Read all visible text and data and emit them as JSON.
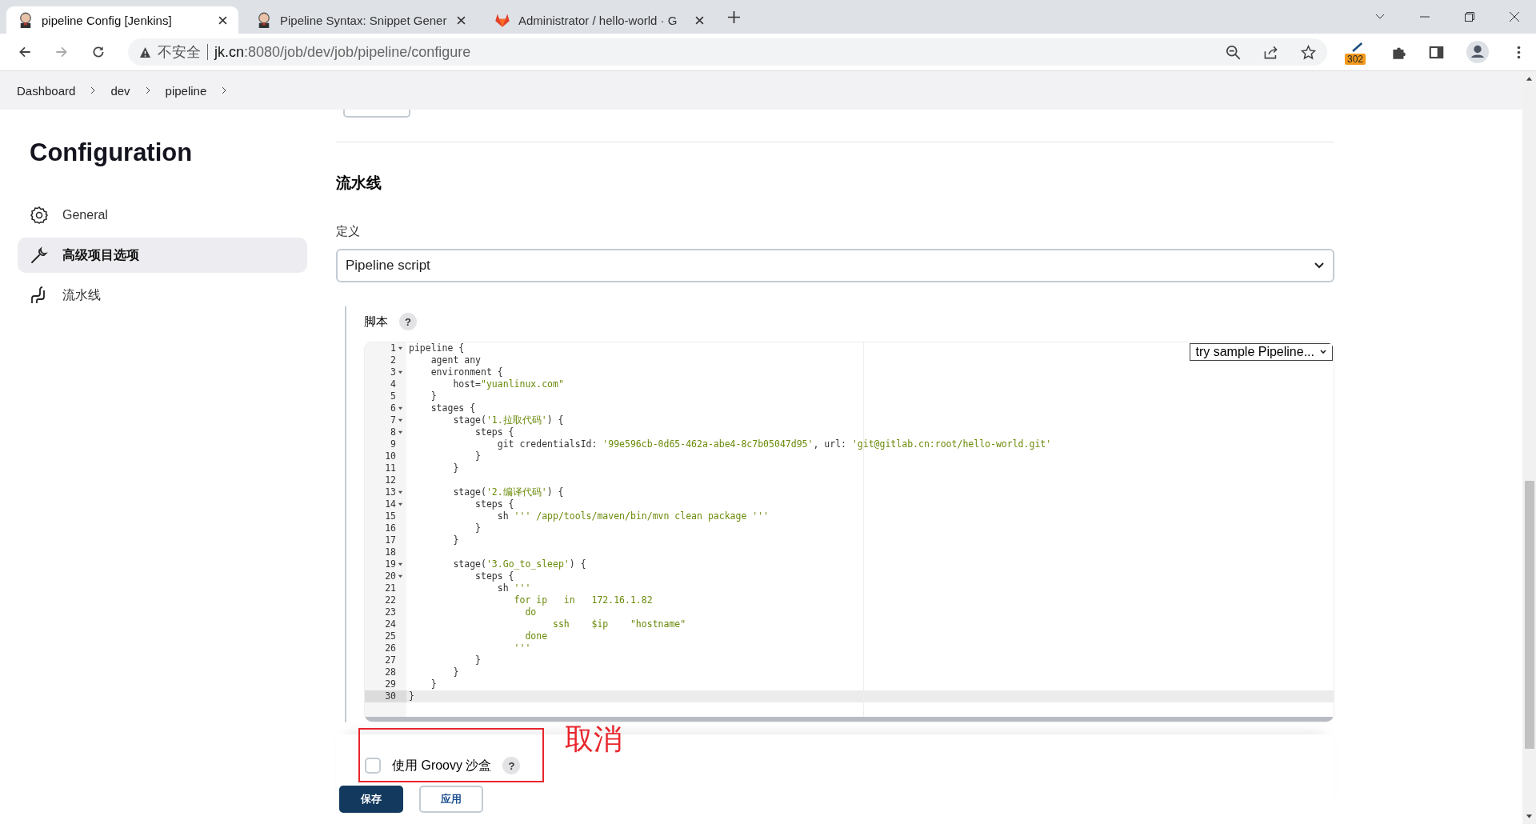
{
  "browser": {
    "tabs": [
      {
        "title": "pipeline Config [Jenkins]",
        "kind": "jenkins",
        "selected": true
      },
      {
        "title": "Pipeline Syntax: Snippet Gener",
        "kind": "jenkins",
        "selected": false
      },
      {
        "title": "Administrator / hello-world · G",
        "kind": "gitlab",
        "selected": false
      }
    ],
    "security": "不安全",
    "url_host": "jk.cn",
    "url_path": ":8080/job/dev/job/pipeline/configure",
    "extension_badge": "302"
  },
  "breadcrumbs": [
    "Dashboard",
    "dev",
    "pipeline"
  ],
  "sidebar": {
    "title": "Configuration",
    "items": [
      {
        "label": "General",
        "kind": "gear",
        "selected": false
      },
      {
        "label": "高级项目选项",
        "kind": "wrench",
        "selected": true
      },
      {
        "label": "流水线",
        "kind": "pipeline",
        "selected": false
      }
    ]
  },
  "section": {
    "title": "流水线",
    "definition_label": "定义",
    "definition_value": "Pipeline script",
    "script_label": "脚本",
    "help": "?",
    "sample_select": "try sample Pipeline...",
    "code": [
      {
        "n": "1",
        "fold": true,
        "active": false,
        "segs": [
          {
            "t": "pipeline {",
            "kind": "plain"
          }
        ]
      },
      {
        "n": "2",
        "fold": false,
        "active": false,
        "segs": [
          {
            "t": "    agent any",
            "kind": "plain"
          }
        ]
      },
      {
        "n": "3",
        "fold": true,
        "active": false,
        "segs": [
          {
            "t": "    environment {",
            "kind": "plain"
          }
        ]
      },
      {
        "n": "4",
        "fold": false,
        "active": false,
        "segs": [
          {
            "t": "        host=",
            "kind": "plain"
          },
          {
            "t": "\"yuanlinux.com\"",
            "kind": "string"
          }
        ]
      },
      {
        "n": "5",
        "fold": false,
        "active": false,
        "segs": [
          {
            "t": "    }",
            "kind": "plain"
          }
        ]
      },
      {
        "n": "6",
        "fold": true,
        "active": false,
        "segs": [
          {
            "t": "    stages {",
            "kind": "plain"
          }
        ]
      },
      {
        "n": "7",
        "fold": true,
        "active": false,
        "segs": [
          {
            "t": "        stage(",
            "kind": "plain"
          },
          {
            "t": "'1.拉取代码'",
            "kind": "string"
          },
          {
            "t": ") {",
            "kind": "plain"
          }
        ]
      },
      {
        "n": "8",
        "fold": true,
        "active": false,
        "segs": [
          {
            "t": "            steps {",
            "kind": "plain"
          }
        ]
      },
      {
        "n": "9",
        "fold": false,
        "active": false,
        "segs": [
          {
            "t": "                git credentialsId: ",
            "kind": "plain"
          },
          {
            "t": "'99e596cb-0d65-462a-abe4-8c7b05047d95'",
            "kind": "string"
          },
          {
            "t": ", url: ",
            "kind": "plain"
          },
          {
            "t": "'git@gitlab.cn:root/hello-world.git'",
            "kind": "string"
          }
        ]
      },
      {
        "n": "10",
        "fold": false,
        "active": false,
        "segs": [
          {
            "t": "            }",
            "kind": "plain"
          }
        ]
      },
      {
        "n": "11",
        "fold": false,
        "active": false,
        "segs": [
          {
            "t": "        }",
            "kind": "plain"
          }
        ]
      },
      {
        "n": "12",
        "fold": false,
        "active": false
      },
      {
        "n": "13",
        "fold": true,
        "active": false,
        "segs": [
          {
            "t": "        stage(",
            "kind": "plain"
          },
          {
            "t": "'2.编译代码'",
            "kind": "string"
          },
          {
            "t": ") {",
            "kind": "plain"
          }
        ]
      },
      {
        "n": "14",
        "fold": true,
        "active": false,
        "segs": [
          {
            "t": "            steps {",
            "kind": "plain"
          }
        ]
      },
      {
        "n": "15",
        "fold": false,
        "active": false,
        "segs": [
          {
            "t": "                sh ",
            "kind": "plain"
          },
          {
            "t": "''' /app/tools/maven/bin/mvn clean package '''",
            "kind": "string"
          }
        ]
      },
      {
        "n": "16",
        "fold": false,
        "active": false,
        "segs": [
          {
            "t": "            }",
            "kind": "plain"
          }
        ]
      },
      {
        "n": "17",
        "fold": false,
        "active": false,
        "segs": [
          {
            "t": "        }",
            "kind": "plain"
          }
        ]
      },
      {
        "n": "18",
        "fold": false,
        "active": false
      },
      {
        "n": "19",
        "fold": true,
        "active": false,
        "segs": [
          {
            "t": "        stage(",
            "kind": "plain"
          },
          {
            "t": "'3.Go_to_sleep'",
            "kind": "string"
          },
          {
            "t": ") {",
            "kind": "plain"
          }
        ]
      },
      {
        "n": "20",
        "fold": true,
        "active": false,
        "segs": [
          {
            "t": "            steps {",
            "kind": "plain"
          }
        ]
      },
      {
        "n": "21",
        "fold": false,
        "active": false,
        "segs": [
          {
            "t": "                sh ",
            "kind": "plain"
          },
          {
            "t": "'''",
            "kind": "string"
          }
        ]
      },
      {
        "n": "22",
        "fold": false,
        "active": false,
        "segs": [
          {
            "t": "                   for ip   in   172.16.1.82",
            "kind": "string"
          }
        ]
      },
      {
        "n": "23",
        "fold": false,
        "active": false,
        "segs": [
          {
            "t": "                     do",
            "kind": "string"
          }
        ]
      },
      {
        "n": "24",
        "fold": false,
        "active": false,
        "segs": [
          {
            "t": "                          ssh    $ip    \"hostname\"",
            "kind": "string"
          }
        ]
      },
      {
        "n": "25",
        "fold": false,
        "active": false,
        "segs": [
          {
            "t": "                     done",
            "kind": "string"
          }
        ]
      },
      {
        "n": "26",
        "fold": false,
        "active": false,
        "segs": [
          {
            "t": "                   '''",
            "kind": "string"
          }
        ]
      },
      {
        "n": "27",
        "fold": false,
        "active": false,
        "segs": [
          {
            "t": "            }",
            "kind": "plain"
          }
        ]
      },
      {
        "n": "28",
        "fold": false,
        "active": false,
        "segs": [
          {
            "t": "        }",
            "kind": "plain"
          }
        ]
      },
      {
        "n": "29",
        "fold": false,
        "active": false,
        "segs": [
          {
            "t": "    }",
            "kind": "plain"
          }
        ]
      },
      {
        "n": "30",
        "fold": false,
        "active": true,
        "segs": [
          {
            "t": "}",
            "kind": "plain"
          }
        ]
      }
    ],
    "sandbox": {
      "label": "使用 Groovy 沙盒",
      "checked": false,
      "help": "?"
    }
  },
  "annotation": {
    "text": "取消"
  },
  "buttons": [
    {
      "label": "保存",
      "kind": "primary"
    },
    {
      "label": "应用",
      "kind": "secondary"
    }
  ]
}
